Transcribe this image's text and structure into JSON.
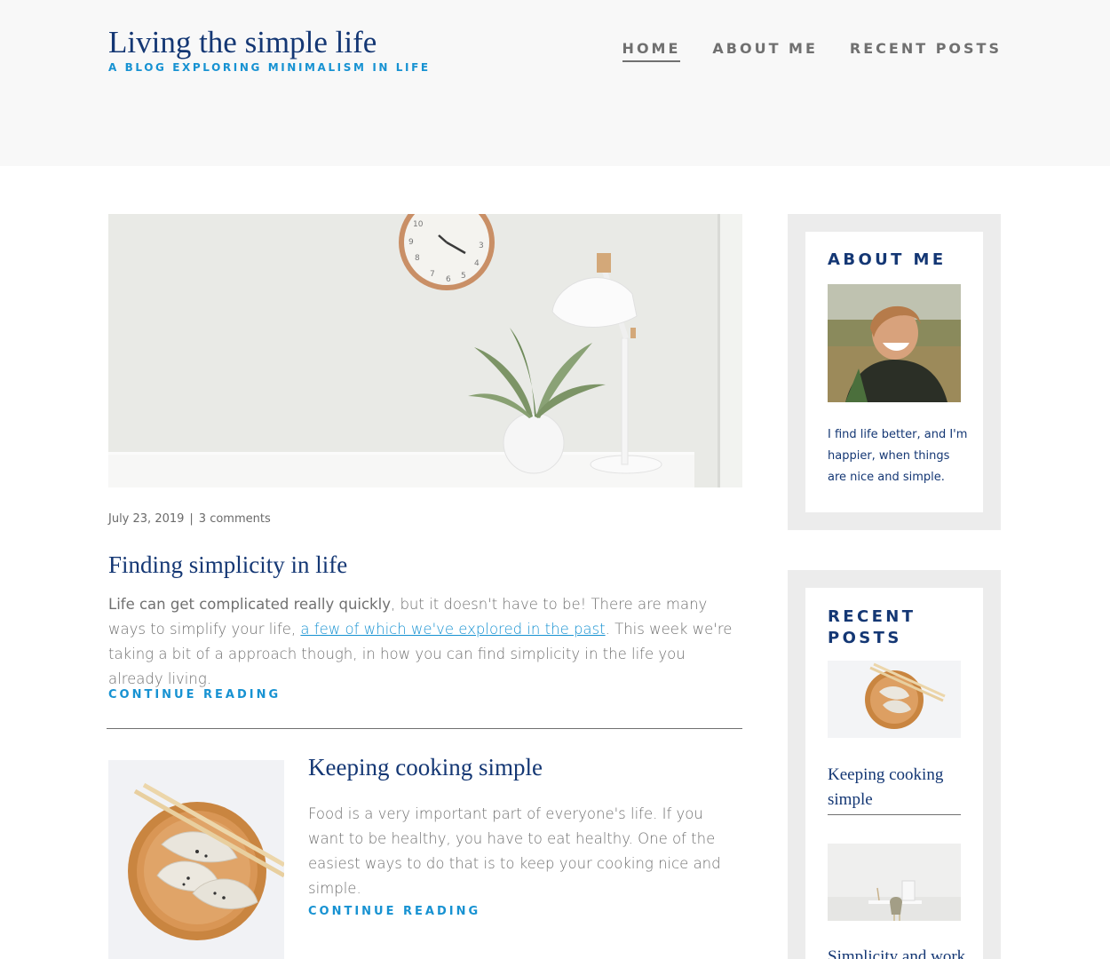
{
  "header": {
    "title": "Living the simple life",
    "subtitle": "A BLOG EXPLORING MINIMALISM IN LIFE",
    "nav": [
      {
        "label": "HOME",
        "current": true
      },
      {
        "label": "ABOUT ME",
        "current": false
      },
      {
        "label": "RECENT POSTS",
        "current": false
      }
    ]
  },
  "featured": {
    "date": "July 23, 2019",
    "separator": "|",
    "comments": "3 comments",
    "title": "Finding simplicity in life",
    "excerpt_bold": "Life can get complicated really quickly",
    "excerpt_part1": ", but it doesn't have to be! There are many ways to simplify your life, ",
    "excerpt_link": "a few of which we've explored in the past",
    "excerpt_part2": ". This week we're taking a bit of a approach though, in how you can find simplicity in the life you already living.",
    "read_more": "CONTINUE READING"
  },
  "second": {
    "title": "Keeping cooking simple",
    "excerpt": "Food is a very important part of everyone's life. If you want to be healthy, you have to eat healthy. One of the easiest ways to do that is to keep your cooking nice and simple.",
    "read_more": "CONTINUE READING"
  },
  "sidebar": {
    "about": {
      "title": "ABOUT ME",
      "text": "I find life better, and I'm happier, when things are nice and simple."
    },
    "recent": {
      "title": "RECENT POSTS",
      "posts": [
        {
          "title": "Keeping cooking simple"
        },
        {
          "title": "Simplicity and work"
        }
      ]
    }
  },
  "colors": {
    "brand_blue": "#143774",
    "accent_blue": "#1792d2",
    "text_gray": "#707070",
    "header_bg": "#f8f8f8",
    "widget_bg": "#ececec"
  },
  "icons": [
    "wall-clock-image",
    "plant-image",
    "lamp-image",
    "dumplings-image",
    "smiling-man-photo",
    "desk-image"
  ]
}
